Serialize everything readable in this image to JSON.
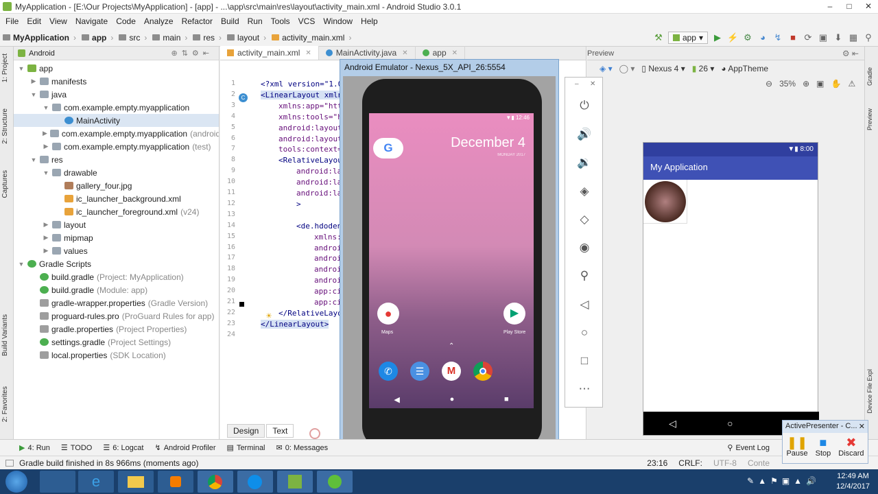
{
  "window": {
    "title": "MyApplication - [E:\\Our Projects\\MyApplication] - [app] - ...\\app\\src\\main\\res\\layout\\activity_main.xml - Android Studio 3.0.1"
  },
  "menu": [
    "File",
    "Edit",
    "View",
    "Navigate",
    "Code",
    "Analyze",
    "Refactor",
    "Build",
    "Run",
    "Tools",
    "VCS",
    "Window",
    "Help"
  ],
  "breadcrumbs": [
    "MyApplication",
    "app",
    "src",
    "main",
    "res",
    "layout",
    "activity_main.xml"
  ],
  "run_config": "app",
  "project_panel": {
    "view": "Android",
    "tabs": [
      "1: Project",
      "2: Structure",
      "Captures",
      "Build Variants",
      "2: Favorites"
    ]
  },
  "tree": [
    {
      "label": "app",
      "hint": "",
      "depth": 0,
      "kind": "module",
      "expanded": true
    },
    {
      "label": "manifests",
      "hint": "",
      "depth": 1,
      "kind": "folder",
      "expanded": false
    },
    {
      "label": "java",
      "hint": "",
      "depth": 1,
      "kind": "folder",
      "expanded": true
    },
    {
      "label": "com.example.empty.myapplication",
      "hint": "",
      "depth": 2,
      "kind": "package",
      "expanded": true
    },
    {
      "label": "MainActivity",
      "hint": "",
      "depth": 3,
      "kind": "class",
      "selected": true
    },
    {
      "label": "com.example.empty.myapplication",
      "hint": "(androidT",
      "depth": 2,
      "kind": "package",
      "expanded": false
    },
    {
      "label": "com.example.empty.myapplication",
      "hint": "(test)",
      "depth": 2,
      "kind": "package",
      "expanded": false
    },
    {
      "label": "res",
      "hint": "",
      "depth": 1,
      "kind": "folder",
      "expanded": true
    },
    {
      "label": "drawable",
      "hint": "",
      "depth": 2,
      "kind": "folder",
      "expanded": true
    },
    {
      "label": "gallery_four.jpg",
      "hint": "",
      "depth": 3,
      "kind": "image"
    },
    {
      "label": "ic_launcher_background.xml",
      "hint": "",
      "depth": 3,
      "kind": "xml"
    },
    {
      "label": "ic_launcher_foreground.xml",
      "hint": "(v24)",
      "depth": 3,
      "kind": "xml"
    },
    {
      "label": "layout",
      "hint": "",
      "depth": 2,
      "kind": "folder",
      "expanded": false
    },
    {
      "label": "mipmap",
      "hint": "",
      "depth": 2,
      "kind": "folder",
      "expanded": false
    },
    {
      "label": "values",
      "hint": "",
      "depth": 2,
      "kind": "folder",
      "expanded": false
    },
    {
      "label": "Gradle Scripts",
      "hint": "",
      "depth": 0,
      "kind": "gradle",
      "expanded": true
    },
    {
      "label": "build.gradle",
      "hint": "(Project: MyApplication)",
      "depth": 1,
      "kind": "gradle"
    },
    {
      "label": "build.gradle",
      "hint": "(Module: app)",
      "depth": 1,
      "kind": "gradle"
    },
    {
      "label": "gradle-wrapper.properties",
      "hint": "(Gradle Version)",
      "depth": 1,
      "kind": "props"
    },
    {
      "label": "proguard-rules.pro",
      "hint": "(ProGuard Rules for app)",
      "depth": 1,
      "kind": "props"
    },
    {
      "label": "gradle.properties",
      "hint": "(Project Properties)",
      "depth": 1,
      "kind": "props"
    },
    {
      "label": "settings.gradle",
      "hint": "(Project Settings)",
      "depth": 1,
      "kind": "gradle"
    },
    {
      "label": "local.properties",
      "hint": "(SDK Location)",
      "depth": 1,
      "kind": "props"
    }
  ],
  "editor_tabs": [
    "activity_main.xml",
    "MainActivity.java",
    "app"
  ],
  "code_lines": [
    {
      "n": "1",
      "text": "<?xml version=\"1.0",
      "indent": 0,
      "attr": false
    },
    {
      "n": "2",
      "text": "<LinearLayout xmln",
      "indent": 0,
      "attr": false
    },
    {
      "n": "3",
      "text": "xmlns:app=\"htt",
      "indent": 2,
      "attr": true
    },
    {
      "n": "4",
      "text": "xmlns:tools=\"h",
      "indent": 2,
      "attr": true
    },
    {
      "n": "5",
      "text": "android:layout",
      "indent": 2,
      "attr": true
    },
    {
      "n": "6",
      "text": "android:layout",
      "indent": 2,
      "attr": true
    },
    {
      "n": "7",
      "text": "tools:context=",
      "indent": 2,
      "attr": true
    },
    {
      "n": "8",
      "text": "<RelativeLayou",
      "indent": 2,
      "attr": false
    },
    {
      "n": "9",
      "text": "android:la",
      "indent": 4,
      "attr": true
    },
    {
      "n": "10",
      "text": "android:la",
      "indent": 4,
      "attr": true
    },
    {
      "n": "11",
      "text": "android:la",
      "indent": 4,
      "attr": true
    },
    {
      "n": "12",
      "text": ">",
      "indent": 4,
      "attr": false
    },
    {
      "n": "13",
      "text": "",
      "indent": 0,
      "attr": false
    },
    {
      "n": "14",
      "text": "<de.hdoden",
      "indent": 4,
      "attr": false
    },
    {
      "n": "15",
      "text": "xmlns:",
      "indent": 6,
      "attr": true
    },
    {
      "n": "16",
      "text": "androi",
      "indent": 6,
      "attr": true
    },
    {
      "n": "17",
      "text": "androi",
      "indent": 6,
      "attr": true
    },
    {
      "n": "18",
      "text": "androi",
      "indent": 6,
      "attr": true
    },
    {
      "n": "19",
      "text": "androi",
      "indent": 6,
      "attr": true
    },
    {
      "n": "20",
      "text": "app:ci",
      "indent": 6,
      "attr": true
    },
    {
      "n": "21",
      "text": "app:ci",
      "indent": 6,
      "attr": true
    },
    {
      "n": "22",
      "text": "</RelativeLayo",
      "indent": 2,
      "attr": false
    },
    {
      "n": "23",
      "text": "</LinearLayout>",
      "indent": 0,
      "attr": false
    },
    {
      "n": "24",
      "text": "",
      "indent": 0,
      "attr": false
    }
  ],
  "design_tabs": [
    "Design",
    "Text"
  ],
  "preview": {
    "title": "Preview",
    "device": "Nexus 4",
    "api": "26",
    "theme": "AppTheme",
    "zoom": "35%",
    "app_title": "My Application",
    "time": "8:00"
  },
  "emulator": {
    "title": "Android Emulator - Nexus_5X_API_26:5554",
    "date": "December 4",
    "date_sub": "MONDAY 2017",
    "time": "12:46",
    "apps": [
      "Maps",
      "Play Store"
    ]
  },
  "bottom_tools": [
    "4: Run",
    "TODO",
    "6: Logcat",
    "Android Profiler",
    "Terminal",
    "0: Messages",
    "Event Log"
  ],
  "status": {
    "message": "Gradle build finished in 8s 966ms (moments ago)",
    "position": "23:16",
    "line_sep": "CRLF:",
    "encoding": "UTF-8",
    "context": "Conte"
  },
  "activepresenter": {
    "title": "ActivePresenter - C...",
    "buttons": [
      "Pause",
      "Stop",
      "Discard"
    ]
  },
  "clock": {
    "time": "12:49 AM",
    "date": "12/4/2017"
  },
  "colors": {
    "toolbar_blue": "#3f51b5",
    "status_blue": "#303f9f",
    "selection": "#dbe6f3",
    "taskbar": "#1a3f6b"
  }
}
